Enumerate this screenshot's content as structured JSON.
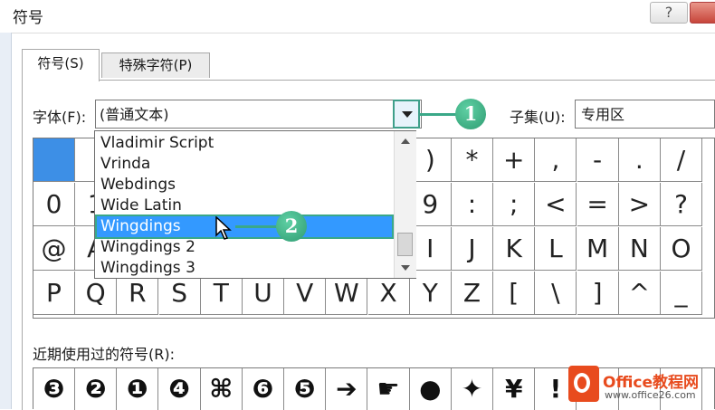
{
  "window": {
    "title": "符号",
    "help_label": "?"
  },
  "tabs": [
    {
      "label": "符号(S)"
    },
    {
      "label": "特殊字符(P)"
    }
  ],
  "font_label": "字体(F):",
  "font_value": "(普通文本)",
  "subset_label": "子集(U):",
  "subset_value": "专用区",
  "font_options": [
    "Vladimir Script",
    "Vrinda",
    "Webdings",
    "Wide Latin",
    "Wingdings",
    "Wingdings 2",
    "Wingdings 3"
  ],
  "highlighted_option": "Wingdings",
  "callouts": {
    "step1": "1",
    "step2": "2"
  },
  "grid_rows": [
    [
      "",
      "",
      "",
      "",
      "",
      "",
      "",
      "",
      "",
      ")",
      "*",
      "+",
      ",",
      "-",
      ".",
      "/"
    ],
    [
      "0",
      "1",
      "",
      "",
      "",
      "",
      "",
      "",
      "",
      "9",
      ":",
      ";",
      "<",
      "=",
      ">",
      "?"
    ],
    [
      "@",
      "A",
      "",
      "",
      "",
      "",
      "",
      "",
      "",
      "I",
      "J",
      "K",
      "L",
      "M",
      "N",
      "O"
    ],
    [
      "P",
      "Q",
      "R",
      "S",
      "T",
      "U",
      "V",
      "W",
      "X",
      "Y",
      "Z",
      "[",
      "\\",
      "]",
      "^",
      "_"
    ]
  ],
  "recent_label": "近期使用过的符号(R):",
  "recent_symbols": [
    "❸",
    "❷",
    "❶",
    "❹",
    "⌘",
    "❻",
    "❺",
    "➔",
    "☛",
    "●",
    "✦",
    "¥",
    "!",
    "",
    "",
    ""
  ],
  "watermark": {
    "title": "Office教程网",
    "url": "www.office26.com"
  },
  "colors": {
    "selection": "#3399ff",
    "callout": "#3aa888",
    "accent": "#e84b1e"
  }
}
